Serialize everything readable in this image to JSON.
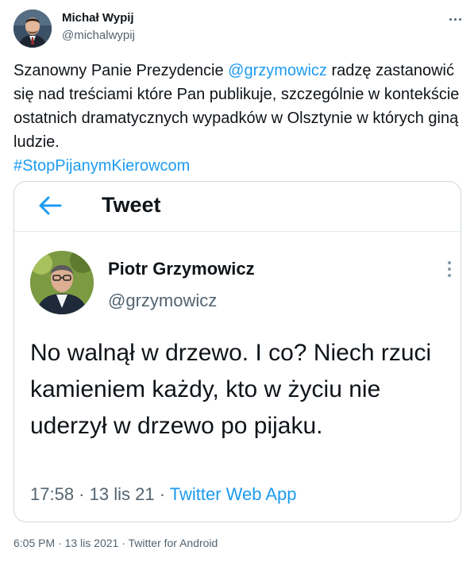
{
  "tweet": {
    "author": {
      "name": "Michał Wypij",
      "handle": "@michalwypij"
    },
    "body": {
      "part1": "Szanowny Panie Prezydencie ",
      "mention": "@grzymowicz",
      "part2": " radzę zastanowić się nad treściami które Pan publikuje, szczególnie w kontekście ostatnich dramatycznych wypadków w Olsztynie w których giną ludzie.",
      "hashtag": "#StopPijanymKierowcom"
    },
    "meta": {
      "time": "6:05 PM",
      "date": "13 lis 2021",
      "source": "Twitter for Android",
      "separator": " · "
    }
  },
  "embedded": {
    "header_title": "Tweet",
    "author": {
      "name": "Piotr Grzymowicz",
      "handle": "@grzymowicz"
    },
    "text": "No walnął w drzewo. I co? Niech rzuci kamieniem każdy, kto w życiu nie uderzył w drzewo po pijaku.",
    "meta": {
      "time": "17:58",
      "date": "13 lis 21",
      "source": "Twitter Web App",
      "separator": " · "
    }
  },
  "colors": {
    "link": "#1d9bf0",
    "secondary_text": "#536471",
    "border": "#cfd9de"
  },
  "icons": [
    "more-horizontal-icon",
    "back-arrow-icon",
    "more-vertical-icon"
  ]
}
